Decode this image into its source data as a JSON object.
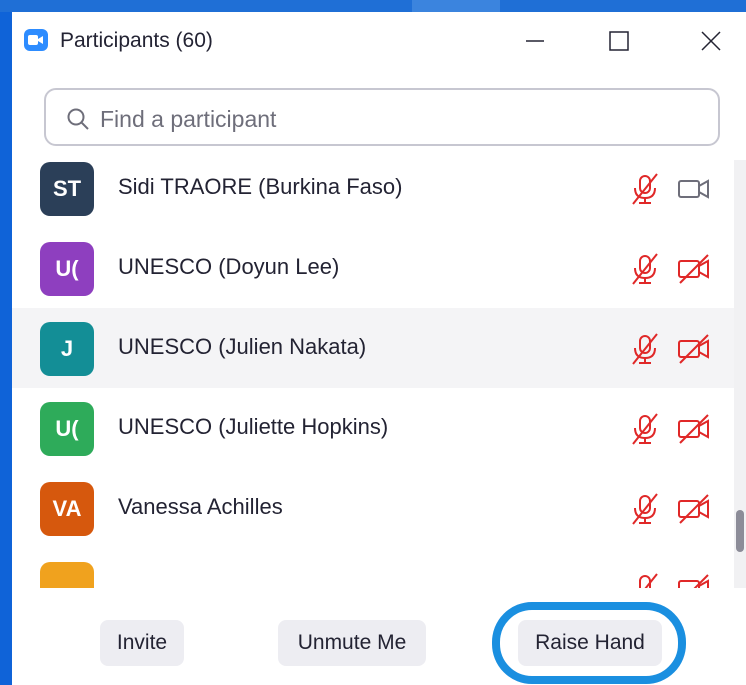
{
  "window": {
    "title": "Participants (60)"
  },
  "search": {
    "placeholder": "Find a participant"
  },
  "participants": [
    {
      "initials": "ST",
      "name": "Sidi TRAORE (Burkina Faso)",
      "avatar_color": "#2b3f58",
      "muted": true,
      "video": "on"
    },
    {
      "initials": "U(",
      "name": "UNESCO (Doyun Lee)",
      "avatar_color": "#8e3fbf",
      "muted": true,
      "video": "off"
    },
    {
      "initials": "J",
      "name": "UNESCO (Julien Nakata)",
      "avatar_color": "#138e96",
      "muted": true,
      "video": "off",
      "hovered": true
    },
    {
      "initials": "U(",
      "name": "UNESCO (Juliette Hopkins)",
      "avatar_color": "#2eab5a",
      "muted": true,
      "video": "off"
    },
    {
      "initials": "VA",
      "name": "Vanessa Achilles",
      "avatar_color": "#d6580d",
      "muted": true,
      "video": "off"
    },
    {
      "initials": "",
      "name": "",
      "avatar_color": "#f0a21e",
      "muted": true,
      "video": "off"
    }
  ],
  "footer": {
    "invite_label": "Invite",
    "unmute_label": "Unmute Me",
    "raise_hand_label": "Raise Hand"
  },
  "colors": {
    "accent": "#2d8cff",
    "muted_icon": "#e02828",
    "highlight": "#1a8fe0"
  }
}
